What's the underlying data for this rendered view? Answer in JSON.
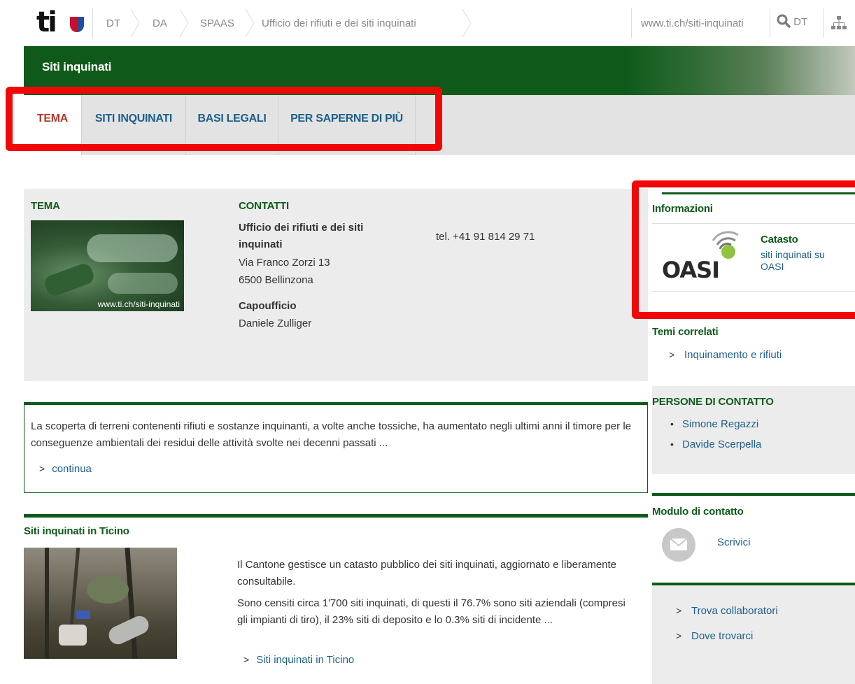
{
  "header": {
    "logo_text": "ti",
    "breadcrumbs": [
      "DT",
      "DA",
      "SPAAS",
      "Ufficio dei rifiuti e dei siti inquinati"
    ],
    "site_link": "www.ti.ch/siti-inquinati",
    "search_label": "DT"
  },
  "banner": {
    "title": "Siti inquinati"
  },
  "tabs": [
    {
      "label": "TEMA",
      "active": true
    },
    {
      "label": "SITI INQUINATI",
      "active": false
    },
    {
      "label": "BASI LEGALI",
      "active": false
    },
    {
      "label": "PER SAPERNE DI PIÙ",
      "active": false
    }
  ],
  "tema": {
    "heading": "TEMA",
    "photo_caption": "www.ti.ch/siti-inquinati"
  },
  "contatti": {
    "heading": "CONTATTI",
    "office_name": "Ufficio dei rifiuti e dei siti inquinati",
    "address_line1": "Via Franco Zorzi 13",
    "address_line2": "6500 Bellinzona",
    "phone": "tel. +41 91 814 29 71",
    "head_title": "Capoufficio",
    "head_name": "Daniele Zulliger"
  },
  "intro": {
    "text": "La scoperta di terreni contenenti rifiuti e sostanze inquinanti, a volte anche tossiche, ha aumentato negli ultimi anni il timore per le conseguenze ambientali dei residui delle attività svolte nei decenni passati ...",
    "link": "continua"
  },
  "ticino": {
    "heading": "Siti inquinati in Ticino",
    "para1": "Il Cantone gestisce un catasto pubblico dei siti inquinati, aggiornato e liberamente consultabile.",
    "para2": "Sono censiti circa 1'700 siti inquinati, di questi il 76.7% sono siti aziendali (compresi gli impianti di tiro), il 23% siti di deposito e lo 0.3% siti di incidente ...",
    "link": "Siti inquinati in Ticino"
  },
  "sidebar": {
    "info_heading": "Informazioni",
    "oasi_logo": "OASI",
    "catasto_title": "Catasto",
    "catasto_link": "siti inquinati su OASI",
    "temi_heading": "Temi correlati",
    "temi_link": "Inquinamento e rifiuti",
    "persone_heading": "PERSONE DI CONTATTO",
    "persone": [
      "Simone Regazzi",
      "Davide Scerpella"
    ],
    "modulo_heading": "Modulo di contatto",
    "modulo_link": "Scrivici",
    "links": [
      "Trova collaboratori",
      "Dove trovarci"
    ]
  },
  "colors": {
    "brand_green": "#0f5a1a",
    "link_blue": "#1d5f8a",
    "active_tab_red": "#b23a2e",
    "highlight_red": "#f00808"
  }
}
